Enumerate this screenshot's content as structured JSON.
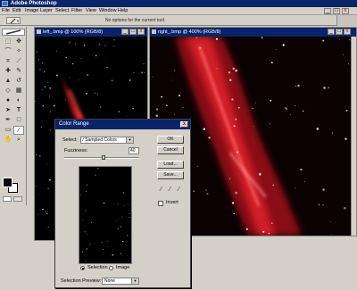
{
  "app": {
    "title": "Adobe Photoshop"
  },
  "menu": [
    "File",
    "Edit",
    "Image",
    "Layer",
    "Select",
    "Filter",
    "View",
    "Window",
    "Help"
  ],
  "options_bar": {
    "text": "No options for the current tool.",
    "tool_icon": "eyedropper-icon"
  },
  "window_controls": {
    "minimize": "_",
    "maximize": "□",
    "close": "x"
  },
  "documents": [
    {
      "title": "left_.bmp @ 100% (RGB/8)"
    },
    {
      "title": "right_.bmp @ 400% (RGB/8)"
    }
  ],
  "toolbox": {
    "tools": [
      "marquee-icon",
      "move-icon",
      "lasso-icon",
      "magic-wand-icon",
      "crop-icon",
      "slice-icon",
      "healing-icon",
      "brush-icon",
      "stamp-icon",
      "history-brush-icon",
      "eraser-icon",
      "gradient-icon",
      "blur-icon",
      "dodge-icon",
      "path-select-icon",
      "type-icon",
      "pen-icon",
      "shape-icon",
      "notes-icon",
      "eyedropper-icon",
      "hand-icon",
      "zoom-icon"
    ],
    "foreground_color": "#000000",
    "background_color": "#ffffff"
  },
  "dialog": {
    "title": "Color Range",
    "select_label": "Select:",
    "select_value": "Sampled Colors",
    "fuzziness_label": "Fuzziness:",
    "fuzziness_value": "40",
    "buttons": {
      "ok": "OK",
      "cancel": "Cancel",
      "load": "Load...",
      "save": "Save..."
    },
    "invert_label": "Invert",
    "radio_selection": "Selection",
    "radio_image": "Image",
    "selection_preview_label": "Selection Preview:",
    "selection_preview_value": "None"
  },
  "colors": {
    "title_bar": "#0a246a",
    "chrome": "#d4d0c8",
    "nebula": "#c8141e"
  }
}
